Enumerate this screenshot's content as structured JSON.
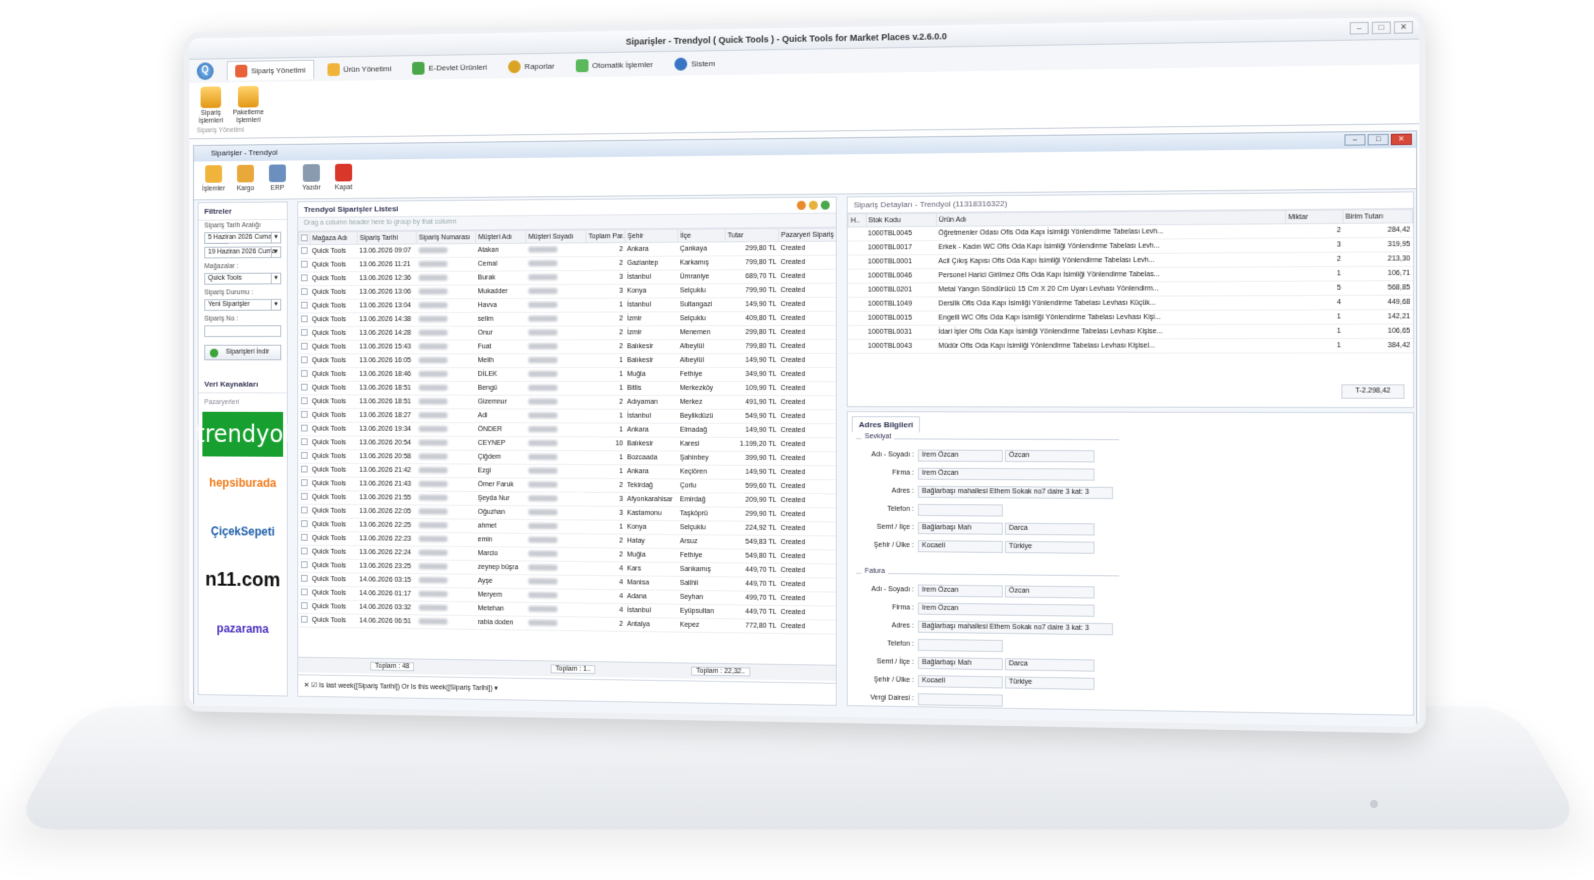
{
  "app": {
    "title": "Siparişler - Trendyol ( Quick Tools ) - Quick Tools for Market Places v.2.6.0.0"
  },
  "ribbon": {
    "tabs": [
      "Sipariş Yönetimi",
      "Ürün Yönetimi",
      "E-Devlet Ürünleri",
      "Raporlar",
      "Otomatik İşlemler",
      "Sistem"
    ],
    "buttons": [
      "Sipariş İşlemleri",
      "Paketleme İşlemleri"
    ],
    "group": "Sipariş Yönetimi"
  },
  "child": {
    "title": "Siparişler - Trendyol",
    "toolbar": [
      "İşlemler",
      "Kargo",
      "ERP",
      "Yazdır",
      "Kapat"
    ]
  },
  "filters": {
    "title": "Filtreler",
    "date_label": "Sipariş Tarih Aralığı",
    "date_from": "5 Haziran 2026   Cuma",
    "date_to": "19 Haziran 2026   Cuma",
    "store_label": "Mağazalar :",
    "store": "Quick Tools",
    "status_label": "Sipariş Durumu :",
    "status": "Yeni Siparişler",
    "no_label": "Sipariş No :",
    "get_button": "Siparişleri İndir"
  },
  "sources": {
    "title": "Veri Kaynakları",
    "group": "Pazaryerleri",
    "logos": [
      "trendyol",
      "hepsiburada",
      "ÇiçekSepeti",
      "n11.com",
      "pazarama"
    ]
  },
  "orders": {
    "title": "Trendyol Siparişler Listesi",
    "hint": "Drag a column header here to group by that column",
    "columns": [
      "Mağaza Adı",
      "Sipariş Tarihi",
      "Sipariş Numarası",
      "Müşteri Adı",
      "Müşteri Soyadı",
      "Toplam Par..",
      "Şehir",
      "İlçe",
      "Tutar",
      "Pazaryeri Sipariş Du"
    ],
    "rows": [
      [
        "Quick Tools",
        "13.06.2026 09:07",
        "Ankara",
        "Çankaya",
        "299,80 TL",
        "Created",
        "2"
      ],
      [
        "Quick Tools",
        "13.06.2026 11:21",
        "Gaziantep",
        "Karkamış",
        "799,80 TL",
        "Created",
        "2"
      ],
      [
        "Quick Tools",
        "13.06.2026 12:36",
        "İstanbul",
        "Ümraniye",
        "689,70 TL",
        "Created",
        "3"
      ],
      [
        "Quick Tools",
        "13.06.2026 13:06",
        "Konya",
        "Selçuklu",
        "799,90 TL",
        "Created",
        "3"
      ],
      [
        "Quick Tools",
        "13.06.2026 13:04",
        "İstanbul",
        "Sultangazi",
        "149,90 TL",
        "Created",
        "1"
      ],
      [
        "Quick Tools",
        "13.06.2026 14:38",
        "İzmir",
        "Selçuklu",
        "409,80 TL",
        "Created",
        "2"
      ],
      [
        "Quick Tools",
        "13.06.2026 14:28",
        "İzmir",
        "Menemen",
        "299,80 TL",
        "Created",
        "2"
      ],
      [
        "Quick Tools",
        "13.06.2026 15:43",
        "Balıkesir",
        "Altıeylül",
        "799,80 TL",
        "Created",
        "2"
      ],
      [
        "Quick Tools",
        "13.06.2026 16:05",
        "Balıkesir",
        "Altıeylül",
        "149,90 TL",
        "Created",
        "1"
      ],
      [
        "Quick Tools",
        "13.06.2026 18:46",
        "Muğla",
        "Fethiye",
        "349,90 TL",
        "Created",
        "1"
      ],
      [
        "Quick Tools",
        "13.06.2026 18:51",
        "Bitlis",
        "Merkezköy",
        "109,90 TL",
        "Created",
        "1"
      ],
      [
        "Quick Tools",
        "13.06.2026 18:51",
        "Adıyaman",
        "Merkez",
        "491,90 TL",
        "Created",
        "2"
      ],
      [
        "Quick Tools",
        "13.06.2026 18:27",
        "İstanbul",
        "Beylikdüzü",
        "549,90 TL",
        "Created",
        "1"
      ],
      [
        "Quick Tools",
        "13.06.2026 19:34",
        "Ankara",
        "Elmadağ",
        "149,90 TL",
        "Created",
        "1"
      ],
      [
        "Quick Tools",
        "13.06.2026 20:54",
        "Balıkesir",
        "Karesi",
        "1.199,20 TL",
        "Created",
        "10"
      ],
      [
        "Quick Tools",
        "13.06.2026 20:58",
        "Bozcaada",
        "Şahinbey",
        "399,90 TL",
        "Created",
        "1"
      ],
      [
        "Quick Tools",
        "13.06.2026 21:42",
        "Ankara",
        "Keçiören",
        "149,90 TL",
        "Created",
        "1"
      ],
      [
        "Quick Tools",
        "13.06.2026 21:43",
        "Tekirdağ",
        "Çorlu",
        "599,60 TL",
        "Created",
        "2"
      ],
      [
        "Quick Tools",
        "13.06.2026 21:55",
        "Afyonkarahisar",
        "Emirdağ",
        "209,90 TL",
        "Created",
        "3"
      ],
      [
        "Quick Tools",
        "13.06.2026 22:05",
        "Kastamonu",
        "Taşköprü",
        "299,90 TL",
        "Created",
        "3"
      ],
      [
        "Quick Tools",
        "13.06.2026 22:25",
        "Konya",
        "Selçuklu",
        "224,92 TL",
        "Created",
        "1"
      ],
      [
        "Quick Tools",
        "13.06.2026 22:23",
        "Hatay",
        "Arsuz",
        "549,83 TL",
        "Created",
        "2"
      ],
      [
        "Quick Tools",
        "13.06.2026 22:24",
        "Muğla",
        "Fethiye",
        "549,80 TL",
        "Created",
        "2"
      ],
      [
        "Quick Tools",
        "13.06.2026 23:25",
        "Kars",
        "Sarıkamış",
        "449,70 TL",
        "Created",
        "4"
      ],
      [
        "Quick Tools",
        "14.06.2026 03:15",
        "Manisa",
        "Salihli",
        "449,70 TL",
        "Created",
        "4"
      ],
      [
        "Quick Tools",
        "14.06.2026 01:17",
        "Adana",
        "Seyhan",
        "499,70 TL",
        "Created",
        "4"
      ],
      [
        "Quick Tools",
        "14.06.2026 03:32",
        "İstanbul",
        "Eyüpsultan",
        "449,70 TL",
        "Created",
        "4"
      ],
      [
        "Quick Tools",
        "14.06.2026 06:51",
        "Antalya",
        "Kepez",
        "772,80 TL",
        "Created",
        "2"
      ]
    ],
    "first_names": [
      "Atakan",
      "Cemal",
      "Burak",
      "Mukadder",
      "Havva",
      "selim",
      "Onur",
      "Fuat",
      "Melih",
      "DİLEK",
      "Bengü",
      "Gizemnur",
      "Adi",
      "ÖNDER",
      "CEYNEP",
      "Çiğdem",
      "Ezgi",
      "Ömer Faruk",
      "Şeyda Nur",
      "Oğuzhan",
      "ahmet",
      "emin",
      "Marcio",
      "zeynep büşra",
      "Ayşe",
      "Meryem",
      "Metehan",
      "rabia doden"
    ],
    "footer": {
      "count": "Toplam : 48",
      "par": "Toplam : 1..",
      "amount": "Toplam : 22,32.."
    },
    "filter_expr": "Is last week([Sipariş Tarihi]) Or Is this week([Sipariş Tarihi])"
  },
  "details": {
    "title": "Sipariş Detayları - Trendyol (11318316322)",
    "columns": [
      "H..",
      "Stok Kodu",
      "Ürün Adı",
      "Miktar",
      "Birim Tutarı"
    ],
    "rows": [
      [
        "1000TBL0045",
        "Öğretmenler Odası Ofis Oda Kapı İsimliği Yönlendirme Tabelası Levh...",
        "2",
        "284,42"
      ],
      [
        "1000TBL0017",
        "Erkek - Kadın WC Ofis Oda Kapı İsimliği Yönlendirme Tabelası Levh...",
        "3",
        "319,95"
      ],
      [
        "1000TBL0001",
        "Acil Çıkış Kapısı Ofis Oda Kapı İsimliği Yönlendirme Tabelası Levh...",
        "2",
        "213,30"
      ],
      [
        "1000TBL0046",
        "Personel Harici Girilmez Ofis Oda Kapı İsimliği Yönlendirme Tabelas...",
        "1",
        "106,71"
      ],
      [
        "1000TBL0201",
        "Metal Yangın Söndürücü 15 Cm X 20 Cm Uyarı Levhası Yönlendirm...",
        "5",
        "568,85"
      ],
      [
        "1000TBL1049",
        "Derslik Ofis Oda Kapı İsimliği Yönlendirme Tabelası Levhası Küçük...",
        "4",
        "449,68"
      ],
      [
        "1000TBL0015",
        "Engelli WC Ofis Oda Kapı İsimliği Yönlendirme Tabelası Levhası Kişi...",
        "1",
        "142,21"
      ],
      [
        "1000TBL0031",
        "İdari İşler Ofis Oda Kapı İsimliği Yönlendirme Tabelası Levhası Kişise...",
        "1",
        "106,65"
      ],
      [
        "1000TBL0043",
        "Müdür Ofis Oda Kapı İsimliği Yönlendirme Tabelası Levhası Kişisel...",
        "1",
        "384,42"
      ]
    ],
    "total": "T-2.298,42"
  },
  "address": {
    "title": "Adres Bilgileri",
    "shipping": {
      "title": "Sevkiyat",
      "name_label": "Adı - Soyadı :",
      "first": "İrem Özcan",
      "last": "Özcan",
      "company_label": "Firma :",
      "company": "İrem Özcan",
      "addr_label": "Adres :",
      "addr": "Bağlarbaşı mahallesi Ethem Sokak no7 daire 3 kat: 3",
      "phone_label": "Telefon :",
      "district_label": "Semt / İlçe :",
      "district": "Bağlarbaşı Mah",
      "town": "Darca",
      "city_label": "Şehir / Ülke :",
      "city": "Kocaeli",
      "country": "Türkiye"
    },
    "billing": {
      "title": "Fatura",
      "name_label": "Adı - Soyadı :",
      "first": "İrem Özcan",
      "last": "Özcan",
      "company_label": "Firma :",
      "company": "İrem Özcan",
      "addr_label": "Adres :",
      "addr": "Bağlarbaşı mahallesi Ethem Sokak no7 daire 3 kat: 3",
      "phone_label": "Telefon :",
      "district_label": "Semt / İlçe :",
      "district": "Bağlarbaşı Mah",
      "town": "Darca",
      "city_label": "Şehir / Ülke :",
      "city": "Kocaeli",
      "country": "Türkiye",
      "tax_label": "Vergi Dairesi :"
    }
  }
}
